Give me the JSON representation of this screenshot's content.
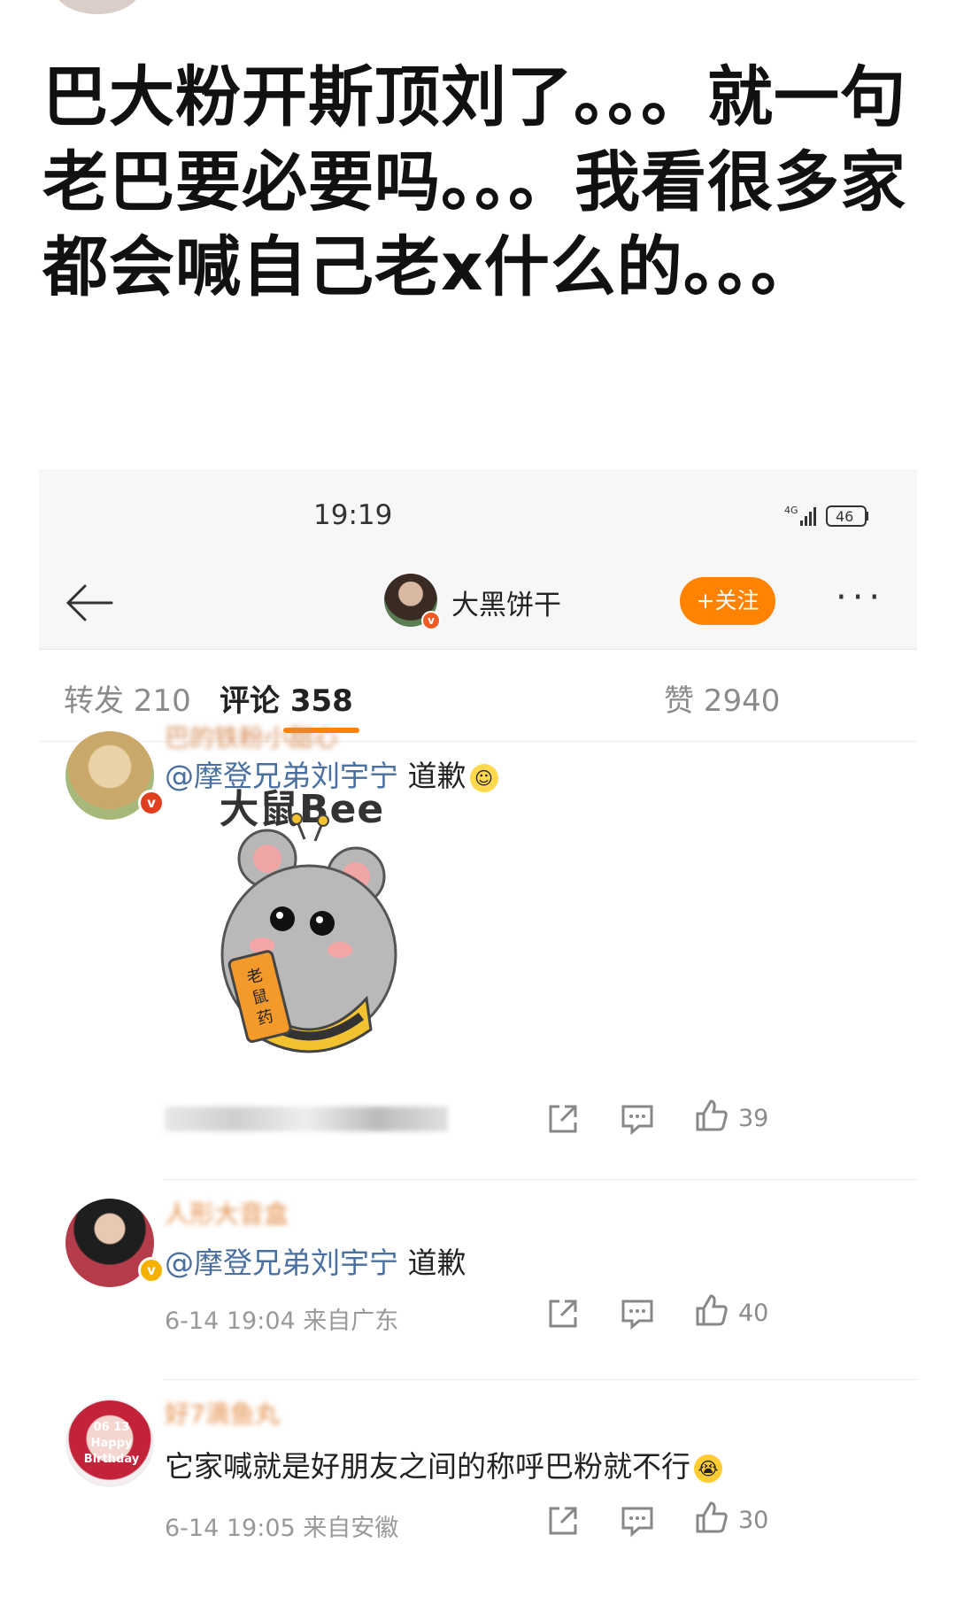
{
  "post": {
    "caption": "巴大粉开斯顶刘了。。。就一句老巴要必要吗。。。我看很多家都会喊自己老x什么的。。。"
  },
  "status_bar": {
    "time": "19:19",
    "network": "4G",
    "battery": "46"
  },
  "nav": {
    "username": "大黑饼干",
    "follow_label": "+关注",
    "more_label": "···"
  },
  "tabs": [
    {
      "label": "转发 210"
    },
    {
      "label": "评论 358"
    },
    {
      "label": "赞 2940"
    }
  ],
  "comments": [
    {
      "username": "巴的铁粉小甜心",
      "mention": "@摩登兄弟刘宇宁",
      "text": " 道歉",
      "sticker_title": "大鼠Bee",
      "sticker_tag": "老鼠药",
      "like_count": "39",
      "verified_color": "#e0401f"
    },
    {
      "username": "人形大音盒",
      "mention": "@摩登兄弟刘宇宁",
      "text": " 道歉",
      "meta": "6-14 19:04  来自广东",
      "like_count": "40",
      "verified_color": "#f5b000"
    },
    {
      "username": "好7滴鱼丸",
      "text": "它家喊就是好朋友之间的称呼巴粉就不行",
      "meta": "6-14 19:05  来自安徽",
      "like_count": "30",
      "avatar_text": "06 13 Happy Birthday"
    }
  ],
  "colors": {
    "accent": "#ff8200",
    "mention": "#4a6fa1"
  }
}
